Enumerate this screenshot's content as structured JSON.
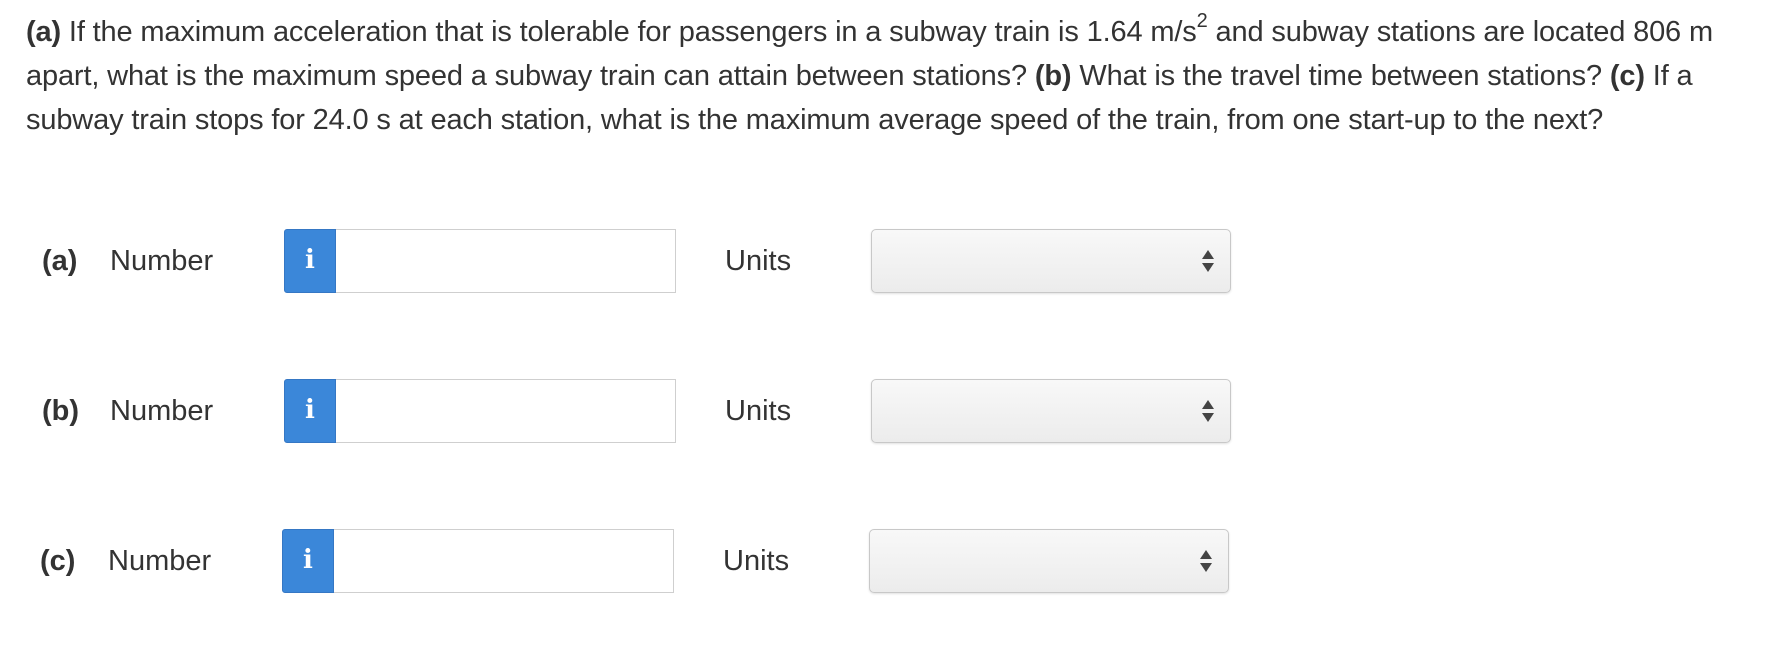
{
  "question": {
    "a_label": "(a)",
    "a_text_1": "If the maximum acceleration that is tolerable for passengers in a subway train is 1.64 m/s",
    "a_sup": "2",
    "a_text_2": "and subway stations are located 806 m apart, what is the maximum speed a subway train can attain between stations?",
    "b_label": "(b)",
    "b_text": "What is the travel time between stations?",
    "c_label": "(c)",
    "c_text": "If a subway train stops for 24.0 s at each station, what is the maximum average speed of the train, from one start-up to the next?"
  },
  "answers": [
    {
      "part": "(a)",
      "number_label": "Number",
      "info_icon": "i",
      "number_value": "",
      "units_label": "Units",
      "units_value": ""
    },
    {
      "part": "(b)",
      "number_label": "Number",
      "info_icon": "i",
      "number_value": "",
      "units_label": "Units",
      "units_value": ""
    },
    {
      "part": "(c)",
      "number_label": "Number",
      "info_icon": "i",
      "number_value": "",
      "units_label": "Units",
      "units_value": ""
    }
  ],
  "colors": {
    "info_button": "#3b87d9",
    "text": "#333333"
  }
}
